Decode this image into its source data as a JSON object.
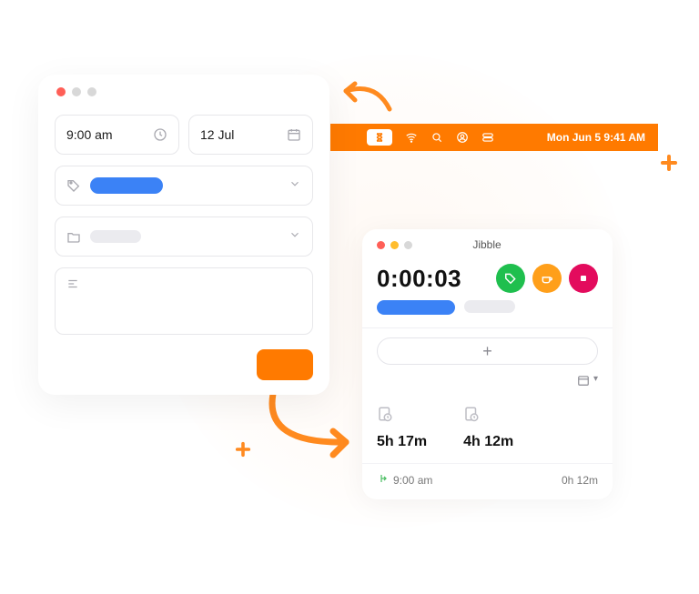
{
  "colors": {
    "accent": "#ff7a00",
    "blue": "#3b82f6",
    "green": "#1fbf4e",
    "amber": "#ff9f1a",
    "magenta": "#e30b5d"
  },
  "left_panel": {
    "time_value": "9:00 am",
    "date_value": "12 Jul"
  },
  "menubar": {
    "datetime": "Mon Jun 5  9:41 AM"
  },
  "right_panel": {
    "app_name": "Jibble",
    "timer": "0:00:03",
    "add_label": "+",
    "stats": [
      {
        "value": "5h 17m"
      },
      {
        "value": "4h 12m"
      }
    ],
    "entry": {
      "time": "9:00 am",
      "duration": "0h 12m"
    }
  }
}
